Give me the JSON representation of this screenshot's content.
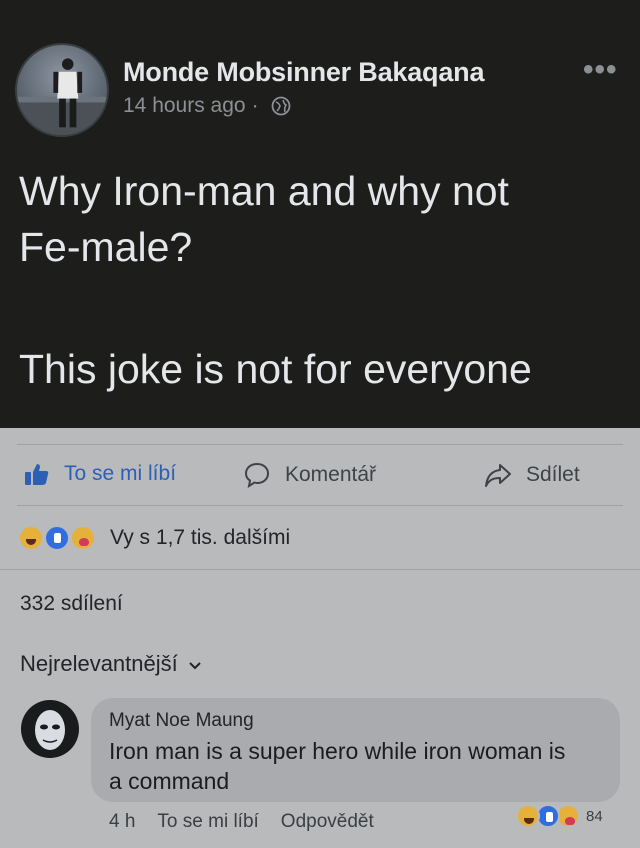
{
  "post": {
    "author": "Monde Mobsinner Bakaqana",
    "time": "14 hours ago",
    "separator": "·",
    "text_line1": "Why Iron-man and why not",
    "text_line2": "Fe-male?",
    "text_line3": "This joke is not for everyone"
  },
  "actions": {
    "like": "To se mi líbí",
    "comment": "Komentář",
    "share": "Sdílet"
  },
  "reactions": {
    "summary": "Vy s 1,7 tis. dalšími",
    "icons": [
      "haha-icon",
      "like-icon",
      "care-icon"
    ]
  },
  "shares": "332 sdílení",
  "sort_label": "Nejrelevantnější",
  "comment": {
    "author": "Myat Noe Maung",
    "text_line1": "Iron man is a super hero while iron woman is",
    "text_line2": "a command",
    "time": "4 h",
    "like": "To se mi líbí",
    "reply": "Odpovědět",
    "reaction_count": "84"
  }
}
